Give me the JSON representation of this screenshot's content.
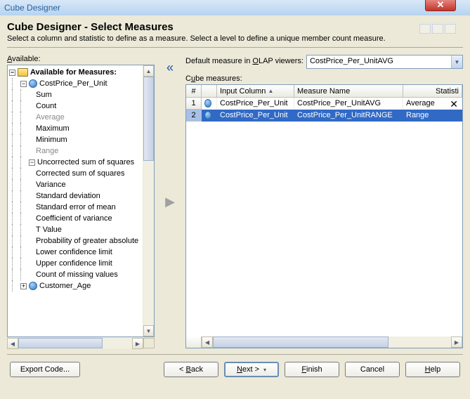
{
  "window": {
    "title": "Cube Designer"
  },
  "page": {
    "title": "Cube Designer - Select Measures",
    "description": "Select a column and statistic to define as a measure.  Select a level to define a unique member count measure."
  },
  "left": {
    "label_html": "Available:",
    "root": "Available for Measures:",
    "items": [
      {
        "label": "CostPrice_Per_Unit",
        "icon": "ball",
        "depth": 1,
        "toggle": "-"
      },
      {
        "label": "Sum",
        "depth": 2
      },
      {
        "label": "Count",
        "depth": 2
      },
      {
        "label": "Average",
        "depth": 2,
        "dim": true
      },
      {
        "label": "Maximum",
        "depth": 2
      },
      {
        "label": "Minimum",
        "depth": 2
      },
      {
        "label": "Range",
        "depth": 2,
        "dim": true
      },
      {
        "label": "Uncorrected sum of squares",
        "depth": 2,
        "sub": "-"
      },
      {
        "label": "Corrected sum of squares",
        "depth": 2
      },
      {
        "label": "Variance",
        "depth": 2
      },
      {
        "label": "Standard deviation",
        "depth": 2
      },
      {
        "label": "Standard error of mean",
        "depth": 2
      },
      {
        "label": "Coefficient of variance",
        "depth": 2
      },
      {
        "label": "T Value",
        "depth": 2
      },
      {
        "label": "Probability of greater absolute",
        "depth": 2
      },
      {
        "label": "Lower confidence limit",
        "depth": 2
      },
      {
        "label": "Upper confidence limit",
        "depth": 2
      },
      {
        "label": "Count of missing values",
        "depth": 2
      },
      {
        "label": "Customer_Age",
        "icon": "ball",
        "depth": 1,
        "toggle": "+"
      }
    ]
  },
  "right": {
    "default_label": "Default measure in OLAP viewers:",
    "default_value": "CostPrice_Per_UnitAVG",
    "cube_label": "Cube measures:",
    "headers": {
      "num": "#",
      "input": "Input Column",
      "measure": "Measure Name",
      "stat": "Statistic"
    },
    "rows": [
      {
        "n": "1",
        "input": "CostPrice_Per_Unit",
        "measure": "CostPrice_Per_UnitAVG",
        "stat": "Average",
        "selected": false
      },
      {
        "n": "2",
        "input": "CostPrice_Per_Unit",
        "measure": "CostPrice_Per_UnitRANGE",
        "stat": "Range",
        "selected": true
      }
    ]
  },
  "buttons": {
    "export": "Export Code...",
    "back": "< Back",
    "next": "Next >",
    "finish": "Finish",
    "cancel": "Cancel",
    "help": "Help"
  }
}
